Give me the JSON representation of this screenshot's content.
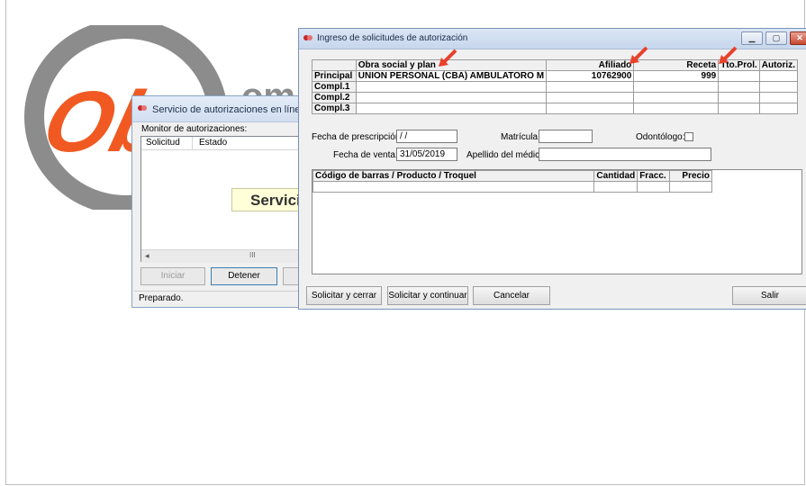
{
  "background_window": {
    "title": "Servicio de autorizaciones en línea",
    "monitor_label": "Monitor de autorizaciones:",
    "columns": [
      "Solicitud",
      "Estado"
    ],
    "banner": "Servicio",
    "scroll_mid": "III",
    "buttons": [
      "Iniciar",
      "Detener"
    ],
    "status": "Preparado."
  },
  "main_window": {
    "title": "Ingreso de solicitudes de autorización",
    "grid_headers": [
      "",
      "Obra social y plan",
      "Afiliado",
      "Receta",
      "Tto.Prol.",
      "Autoriz."
    ],
    "grid_rows": [
      {
        "label": "Principal",
        "plan": "UNION PERSONAL (CBA) AMBULATORO M",
        "afiliado": "10762900",
        "receta": "999"
      },
      {
        "label": "Compl.1",
        "plan": "",
        "afiliado": "",
        "receta": ""
      },
      {
        "label": "Compl.2",
        "plan": "",
        "afiliado": "",
        "receta": ""
      },
      {
        "label": "Compl.3",
        "plan": "",
        "afiliado": "",
        "receta": ""
      }
    ],
    "form": {
      "fecha_prescripcion_label": "Fecha de prescripción:",
      "fecha_prescripcion_value": " / /",
      "matricula_label": "Matrícula:",
      "odontologo_label": "Odontólogo:",
      "fecha_venta_label": "Fecha de venta:",
      "fecha_venta_value": "31/05/2019",
      "apellido_label": "Apellido del médico:"
    },
    "product_headers": [
      "Código de barras / Producto / Troquel",
      "Cantidad",
      "Fracc.",
      "Precio"
    ],
    "buttons": {
      "solicitar_cerrar": "Solicitar y cerrar",
      "solicitar_continuar": "Solicitar y continuar",
      "cancelar": "Cancelar",
      "salir": "Salir"
    }
  },
  "colors": {
    "logo_orange": "#f05a22",
    "logo_gray": "#8c8c8c",
    "arrow_red": "#e8412c"
  },
  "icons": [
    "app-icon",
    "minimize-icon",
    "maximize-icon",
    "close-icon",
    "arrow-icon"
  ]
}
